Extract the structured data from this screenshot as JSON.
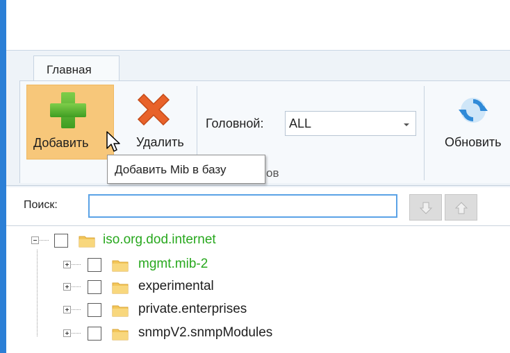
{
  "ribbon": {
    "tab_main": "Главная",
    "add_button": "Добавить",
    "delete_button": "Удалить",
    "head_label": "Головной:",
    "head_value": "ALL",
    "group_label_fragment": "ов",
    "refresh_button": "Обновить"
  },
  "tooltip": {
    "text": "Добавить Mib в базу"
  },
  "search": {
    "label": "Поиск:",
    "value": ""
  },
  "tree": {
    "root": "iso.org.dod.internet",
    "children": [
      "mgmt.mib-2",
      "experimental",
      "private.enterprises",
      "snmpV2.snmpModules"
    ]
  },
  "colors": {
    "accent": "#2b7fd6",
    "add_highlight": "#f7c77a",
    "tree_green": "#28a81e",
    "search_border": "#5aa2e6"
  },
  "icons": {
    "add": "plus-icon",
    "delete": "x-icon",
    "refresh": "refresh-icon",
    "folder": "folder-icon",
    "move_down": "arrow-down-icon",
    "move_up": "arrow-up-icon"
  }
}
